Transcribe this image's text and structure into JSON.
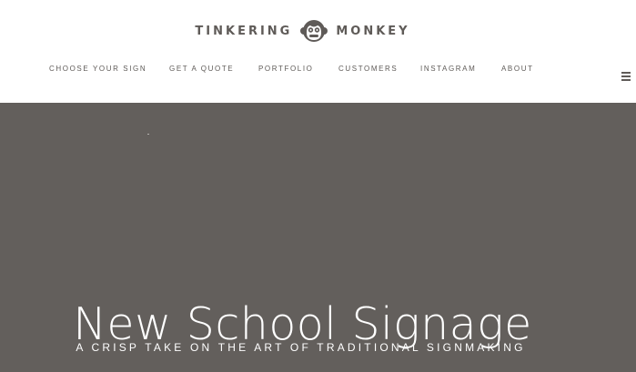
{
  "brand": {
    "name_left": "TINKERING",
    "name_right": "MONKEY",
    "logo_icon": "monkey-face-icon",
    "color": "#5f5b58"
  },
  "nav": {
    "items": [
      {
        "label": "CHOOSE YOUR SIGN"
      },
      {
        "label": "GET A QUOTE"
      },
      {
        "label": "PORTFOLIO"
      },
      {
        "label": "CUSTOMERS"
      },
      {
        "label": "INSTAGRAM"
      },
      {
        "label": "ABOUT"
      }
    ],
    "menu_icon": "hamburger-menu-icon"
  },
  "hero": {
    "title": "New School Signage",
    "subtitle": "A CRISP TAKE ON THE ART OF TRADITIONAL SIGNMAKING",
    "background": "#635f5c",
    "text_color": "#ffffff"
  }
}
